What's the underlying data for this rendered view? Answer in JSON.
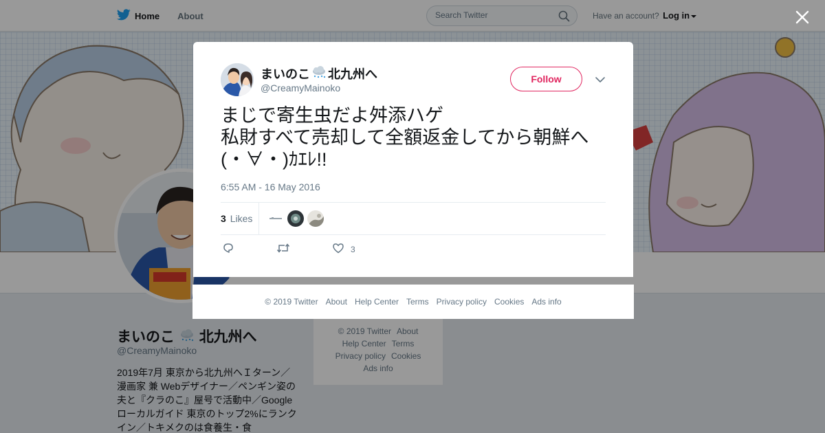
{
  "nav": {
    "home_label": "Home",
    "about_label": "About",
    "search_placeholder": "Search Twitter",
    "account_prompt": "Have an account?",
    "login_label": "Log in"
  },
  "profile": {
    "name_prefix": "まいのこ",
    "name_suffix": "北九州へ",
    "handle": "@CreamyMainoko",
    "bio": "2019年7月 東京から北九州へＩターン／漫画家 兼 Webデザイナー／ペンギン姿の夫と『クラのこ』屋号で活動中／Googleローカルガイド 東京のトップ2%にランクイン／トキメクのは食養生・食"
  },
  "side_footer": {
    "items": [
      "© 2019 Twitter",
      "About",
      "Help Center",
      "Terms",
      "Privacy policy",
      "Cookies",
      "Ads info"
    ]
  },
  "tweet": {
    "author_prefix": "まいのこ",
    "author_suffix": "北九州へ",
    "handle": "@CreamyMainoko",
    "follow_label": "Follow",
    "text_lines": [
      "まじで寄生虫だよ舛添ハゲ",
      "私財すべて売却して全額返金してから朝鮮へ",
      "(・∀・)ｶｴﾚ!!"
    ],
    "timestamp": "6:55 AM - 16 May 2016",
    "likes_count": "3",
    "likes_label": "Likes",
    "action_like_count": "3"
  },
  "footer": {
    "copyright": "© 2019 Twitter",
    "about": "About",
    "help": "Help Center",
    "terms": "Terms",
    "privacy": "Privacy policy",
    "cookies": "Cookies",
    "ads": "Ads info"
  },
  "colors": {
    "follow_accent": "#e0245e",
    "twitter_blue": "#1da1f2",
    "text_secondary": "#657786"
  },
  "icons": {
    "logo": "twitter-bird-icon",
    "search": "search-icon",
    "close": "close-icon",
    "more": "chevron-down-icon",
    "reply": "reply-icon",
    "retweet": "retweet-icon",
    "like": "heart-icon",
    "weather": "snow-cloud-icon"
  }
}
